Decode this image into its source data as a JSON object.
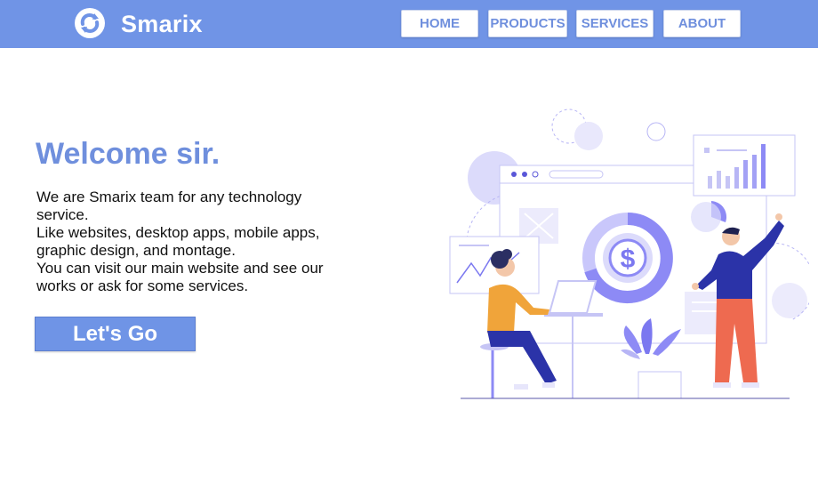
{
  "brand": {
    "name": "Smarix",
    "logo_icon": "refresh-cycle-icon"
  },
  "nav": {
    "items": [
      {
        "label": "HOME"
      },
      {
        "label": "PRODUCTS"
      },
      {
        "label": "SERVICES"
      },
      {
        "label": "ABOUT"
      }
    ]
  },
  "hero": {
    "title": "Welcome sir.",
    "lines": [
      "We are Smarix team for any technology service.",
      "Like websites, desktop apps, mobile apps, graphic design, and montage.",
      "You can visit our main website and see our works or ask for some services."
    ],
    "cta_label": "Let's Go"
  },
  "illustration": {
    "currency_symbol": "$",
    "icon": "business-team-illustration"
  },
  "colors": {
    "navbar": "#7094e6",
    "accent": "#6f8fdd",
    "illustration_purple": "#7b78f0",
    "shirt_orange": "#f0a43a",
    "pants_red": "#ee6a50",
    "dark_blue": "#2b33a8"
  }
}
